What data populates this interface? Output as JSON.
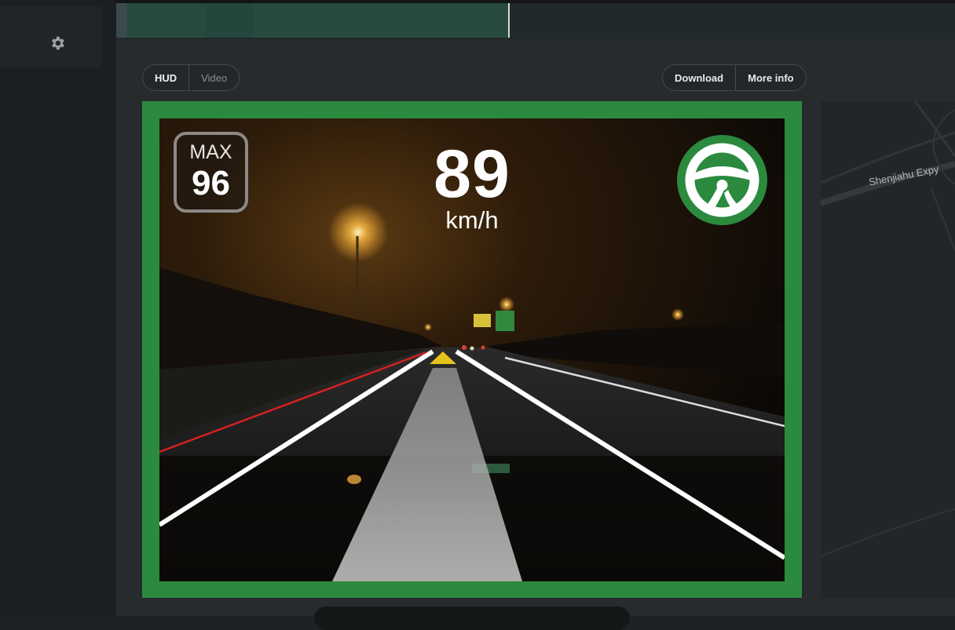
{
  "timeline": {
    "progress": 0.468
  },
  "view_toggle": {
    "hud_label": "HUD",
    "video_label": "Video",
    "selected": "HUD"
  },
  "actions": {
    "download_label": "Download",
    "more_info_label": "More info"
  },
  "hud": {
    "max_label": "MAX",
    "max_speed": "96",
    "speed": "89",
    "speed_unit": "km/h",
    "engaged_icon": "steering-wheel-icon",
    "status_color": "#2b8a3e"
  },
  "map": {
    "road_label": "Shenjiahu Expy"
  },
  "sidebar": {
    "settings_icon": "gear-icon"
  }
}
